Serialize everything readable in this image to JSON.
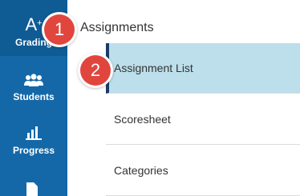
{
  "sidebar": {
    "grading": {
      "icon_text": "A",
      "icon_sup": "+",
      "label": "Grading"
    },
    "students": {
      "icon": "students-icon",
      "label": "Students"
    },
    "progress": {
      "icon": "progress-chart-icon",
      "label": "Progress"
    },
    "next": {
      "icon": "document-icon"
    }
  },
  "main": {
    "heading": "Assignments",
    "items": [
      {
        "label": "Assignment List",
        "active": true
      },
      {
        "label": "Scoresheet",
        "active": false
      },
      {
        "label": "Categories",
        "active": false
      }
    ]
  },
  "callouts": [
    "1",
    "2"
  ],
  "colors": {
    "sidebar_bg": "#1568a8",
    "active_item_bg": "#bcdfeb",
    "active_indicator": "#1a3c66",
    "callout_bg": "#e0463e"
  }
}
